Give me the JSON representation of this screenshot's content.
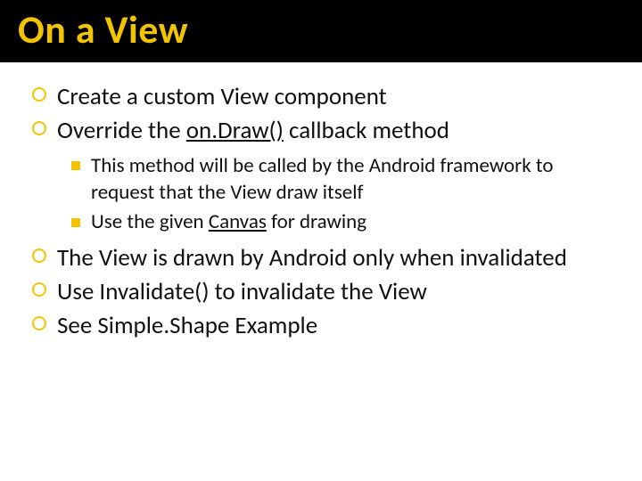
{
  "slide": {
    "title": "On a View",
    "bullets": [
      {
        "text": "Create a custom View component"
      },
      {
        "pre": "Override the ",
        "link": "on.Draw()",
        "post": " callback method",
        "sub": [
          {
            "text": "This method will be called by the Android framework to request that the View draw itself"
          },
          {
            "pre": "Use the given ",
            "link": "Canvas",
            "post": " for drawing"
          }
        ]
      },
      {
        "text": "The View is drawn by Android only when invalidated"
      },
      {
        "text": "Use Invalidate() to invalidate the View"
      },
      {
        "text": "See Simple.Shape Example"
      }
    ]
  }
}
